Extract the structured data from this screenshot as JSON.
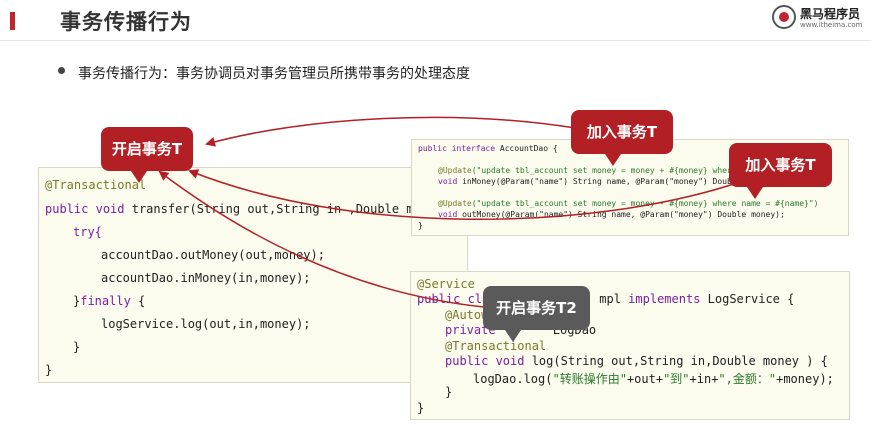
{
  "header": {
    "title": "事务传播行为",
    "logo_name": "黑马程序员",
    "logo_url": "www.itheima.com"
  },
  "bullet": {
    "text": "事务传播行为：事务协调员对事务管理员所携带事务的处理态度"
  },
  "colors": {
    "accent": "#c0262d",
    "bubble_red": "#b22026",
    "bubble_gray": "#5a5a5a",
    "code_bg": "#fbfbee"
  },
  "service_code": {
    "annotation": "@Transactional",
    "line_public": "public",
    "line_void": "void",
    "line_method": "transfer(String out,String in ,Double money){",
    "try_kw": "try{",
    "out_money": "accountDao.outMoney(out,money);",
    "in_money": "accountDao.inMoney(in,money);",
    "finally_brace": "}",
    "finally_kw": "finally",
    "finally_open": " {",
    "log_call": "logService.log(out,in,money);",
    "close_inner": "}",
    "close_outer": "}"
  },
  "dao_code": {
    "line1_kw": "public interface",
    "line1_rest": " AccountDao {",
    "update1_ann": "@Update",
    "update1_str": "(\"update tbl_account set money = money + #{money} where name = #{name}\")",
    "inmoney_void": "void",
    "inmoney_rest": " inMoney(@Param(\"name\") String name, @Param(\"money\") Double money);",
    "update2_ann": "@Update",
    "update2_str": "(\"update tbl_account set money = money - #{money} where name = #{name}\")",
    "outmoney_void": "void",
    "outmoney_rest": " outMoney(@Param(\"name\") String name, @Param(\"money\") Double money);",
    "close": "}"
  },
  "log_code": {
    "service_ann": "@Service",
    "class_public": "public",
    "class_cl": " cla",
    "class_impl": "mpl",
    "class_implements": " implements",
    "class_rest": " LogService {",
    "autowired": "@Autow",
    "private_kw": "private",
    "logdao_partial": " LogDao",
    "transactional": "@Transactional",
    "log_public": "public void",
    "log_sig": " log(String out,String in,Double money ) {",
    "logdao_call": "logDao.log(",
    "log_str1": "\"转账操作由\"",
    "log_plus1": "+out+",
    "log_str2": "\"到\"",
    "log_plus2": "+in+",
    "log_str3": "\",金额：\"",
    "log_tail": "+money);",
    "close_method": "}",
    "close_class": "}"
  },
  "bubbles": {
    "open_tx": "开启事务T",
    "join_tx_1": "加入事务T",
    "join_tx_2": "加入事务T",
    "open_tx2": "开启事务T2"
  }
}
